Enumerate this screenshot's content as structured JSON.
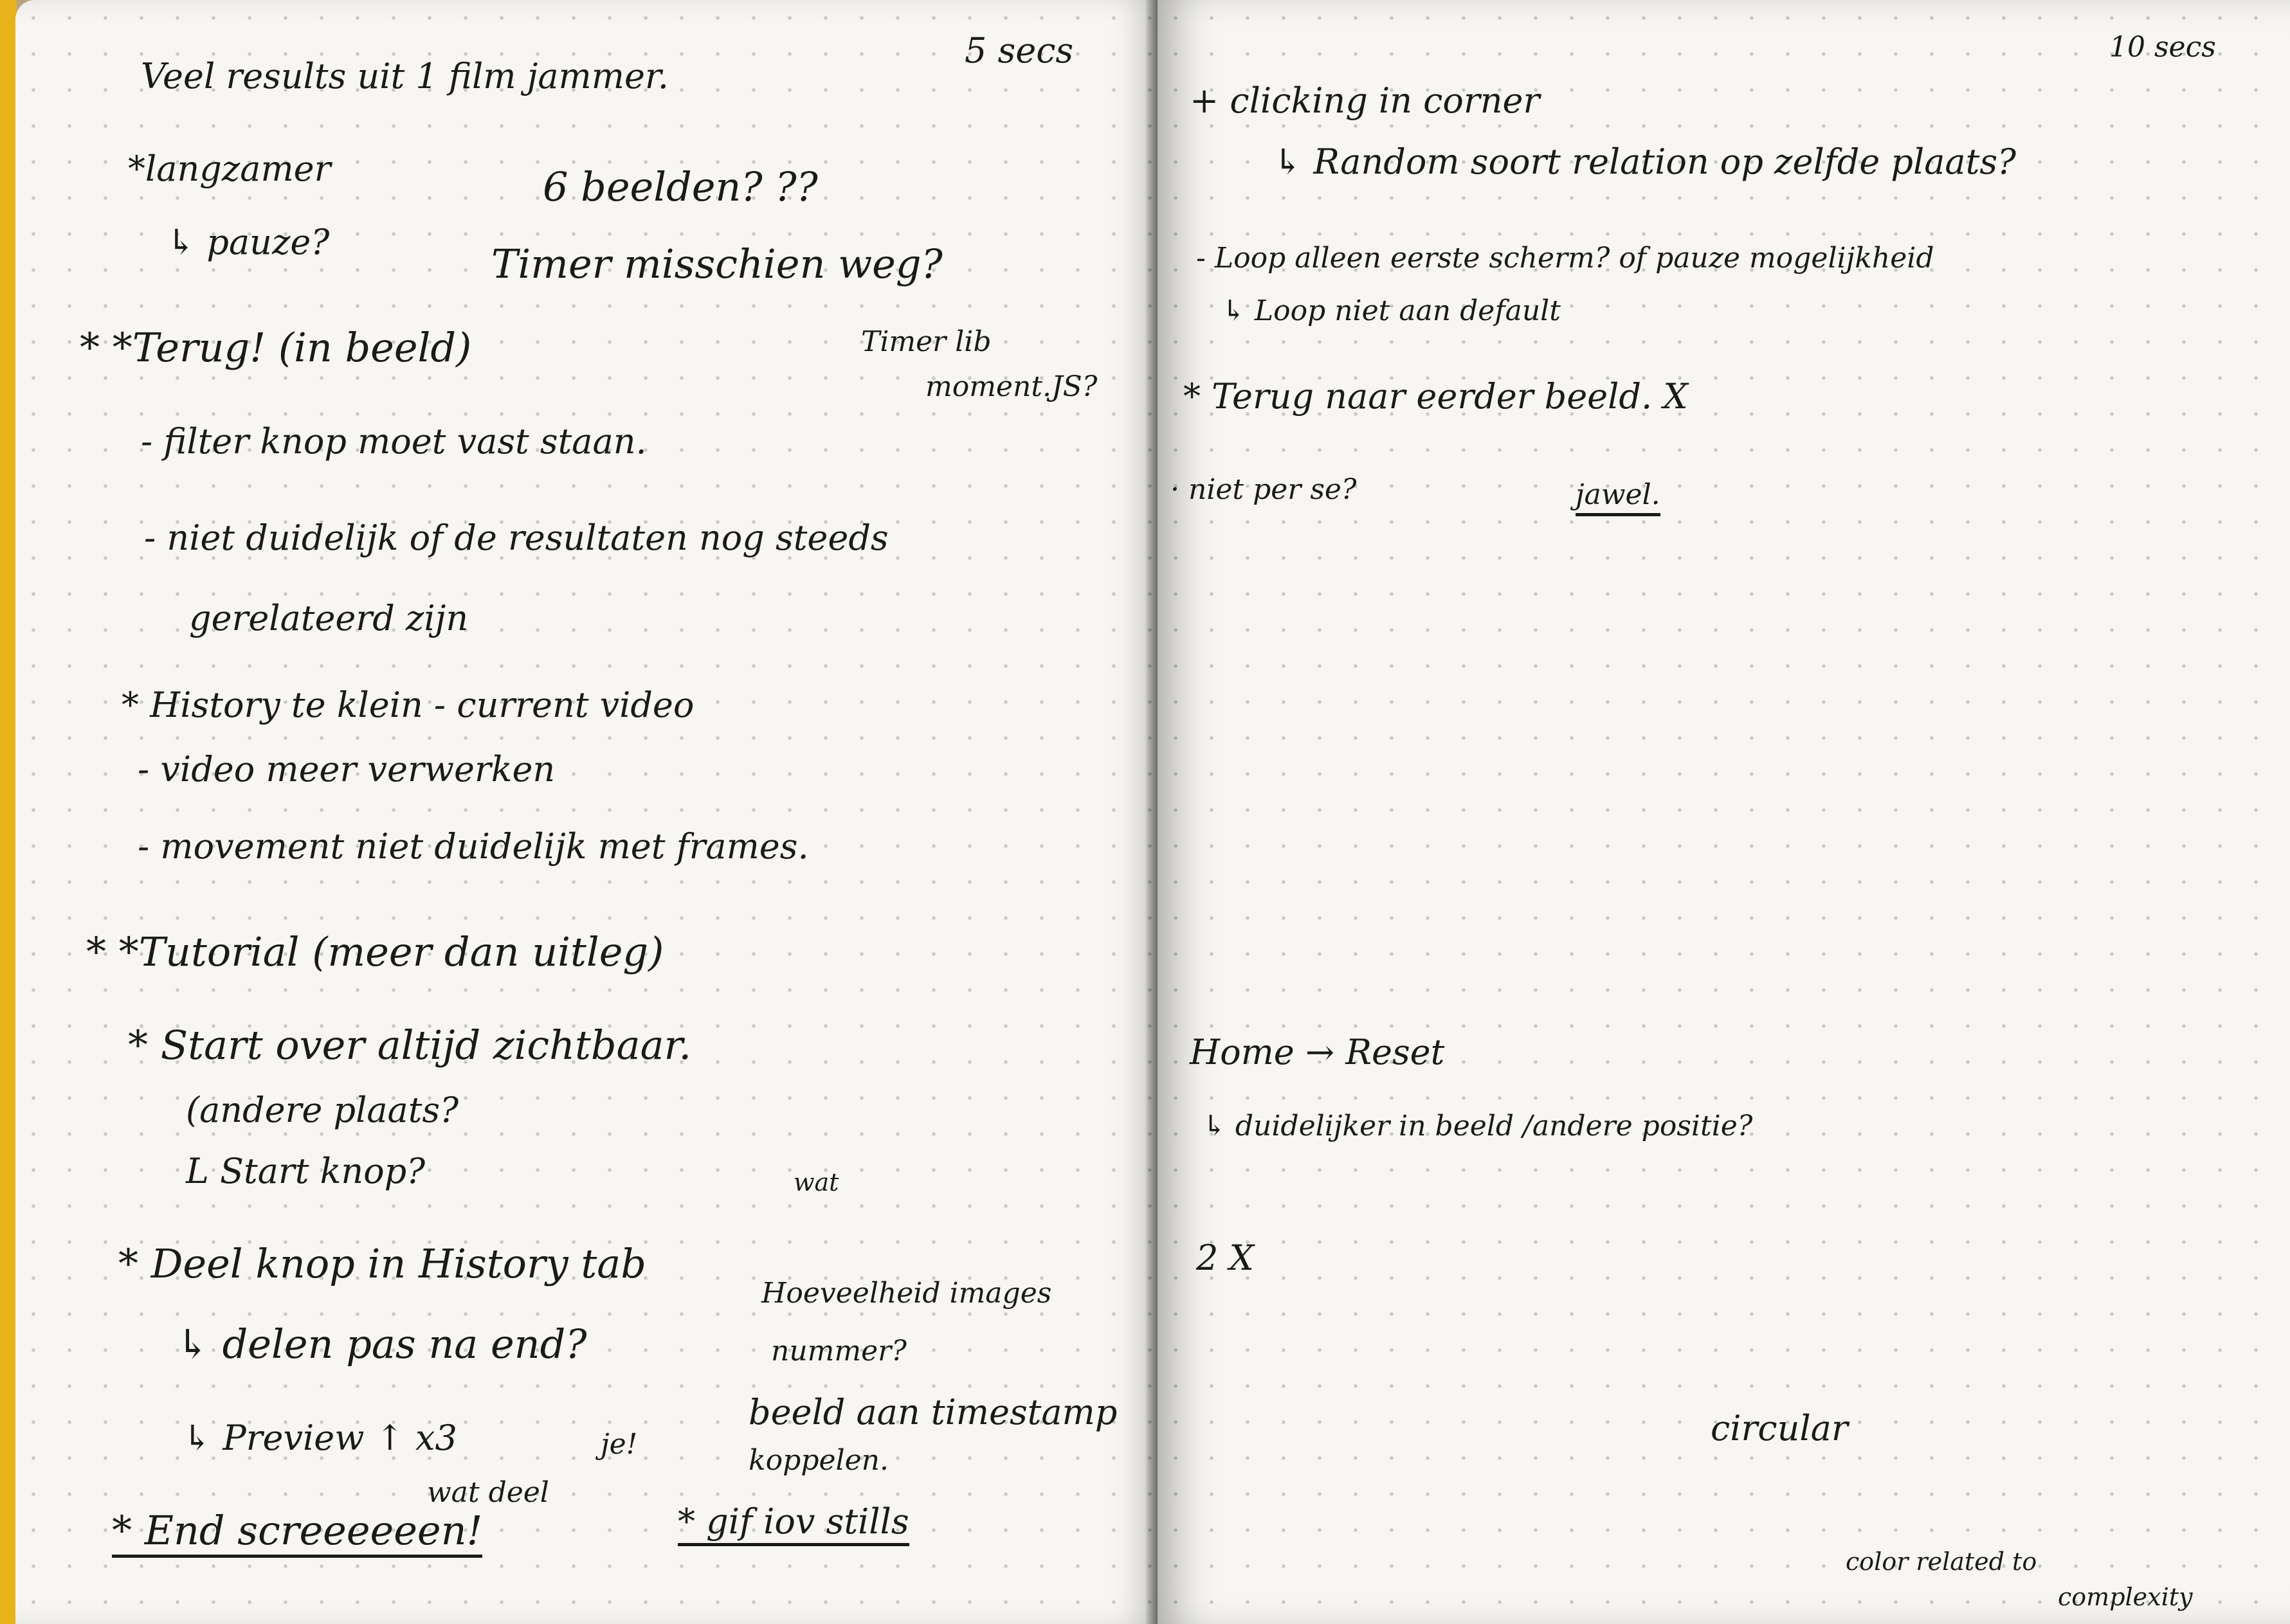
{
  "left_page": {
    "corner": "5 secs",
    "lines": [
      "Veel results uit 1 film jammer.",
      "*langzamer",
      "6 beelden? ??",
      "↳ pauze?",
      "Timer misschien weg?",
      "* *Terug! (in beeld)",
      "Timer lib",
      "moment.JS?",
      "- filter knop moet vast staan.",
      "- niet duidelijk of de resultaten nog steeds",
      "gerelateerd zijn",
      "* History te klein - current video",
      "- video meer verwerken",
      "- movement niet duidelijk met frames.",
      "* *Tutorial (meer dan uitleg)",
      "* Start over altijd zichtbaar.",
      "(andere plaats?",
      "L Start knop?",
      "wat",
      "* Deel knop in History tab",
      "Hoeveelheid images",
      "nummer?",
      "↳ delen pas na end?",
      "beeld aan timestamp",
      "koppelen.",
      "↳ Preview ↑ x3",
      "je!",
      "wat deel",
      "* End screeeeeen!",
      "* gif iov stills"
    ]
  },
  "right_page": {
    "corner": "10 secs",
    "lines": [
      "+ clicking in corner",
      "↳ Random soort relation op zelfde plaats?",
      "- Loop alleen eerste scherm? of pauze mogelijkheid",
      "↳ Loop niet aan default",
      "* Terug naar eerder beeld. X",
      "· niet per se?",
      "jawel.",
      "Home → Reset",
      "↳ duidelijker in beeld /andere positie?",
      "2 X",
      "circular",
      "color related to",
      "complexity"
    ]
  }
}
